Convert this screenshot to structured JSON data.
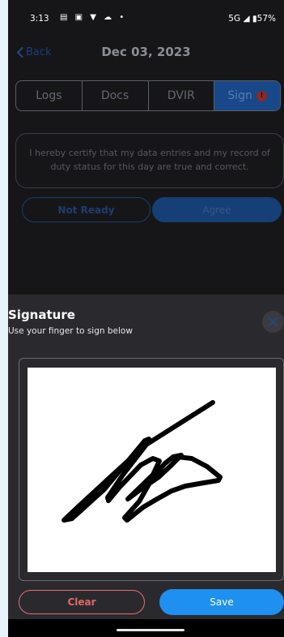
{
  "status": {
    "time": "3:13",
    "icons": [
      "teams-icon",
      "linkedin-icon",
      "shield-icon",
      "cloud-icon",
      "dot-icon"
    ],
    "network": "5G",
    "battery": "57%"
  },
  "header": {
    "back_label": "Back",
    "title": "Dec 03, 2023"
  },
  "tabs": [
    {
      "label": "Logs"
    },
    {
      "label": "Docs"
    },
    {
      "label": "DVIR"
    },
    {
      "label": "Sign",
      "badge": "!",
      "active": true
    }
  ],
  "certification": {
    "text": "I hereby certify that my data entries and my record of duty status for this day are true and correct."
  },
  "actions": {
    "not_ready_label": "Not Ready",
    "agree_label": "Agree"
  },
  "signature_sheet": {
    "title": "Signature",
    "subtitle": "Use your finger to sign below",
    "clear_label": "Clear",
    "save_label": "Save"
  },
  "colors": {
    "accent": "#1e90f0",
    "danger": "#e06868",
    "background": "#161618",
    "sheet": "#2a2a2e"
  }
}
